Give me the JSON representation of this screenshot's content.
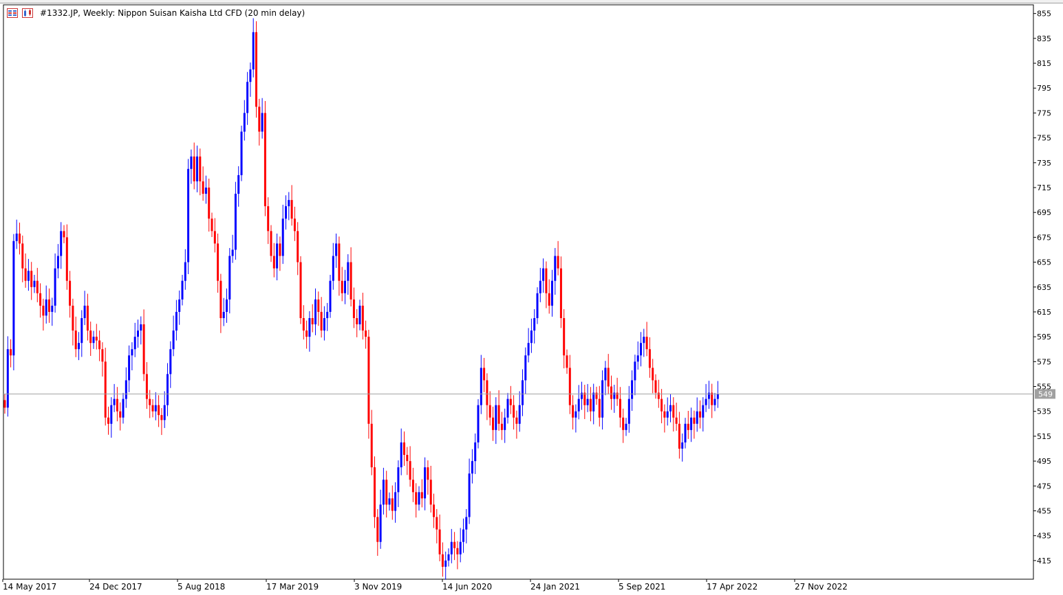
{
  "header": {
    "title": "#1332.JP, Weekly:  Nippon Suisan Kaisha Ltd CFD (20 min delay)"
  },
  "icons": {
    "left": "trade-panel-icon",
    "right": "chart-type-icon"
  },
  "colors": {
    "bull": "#0000ff",
    "bear": "#ff0000",
    "grid_frame": "#000000",
    "price_line": "#a0a0a0",
    "price_label_bg": "#a0a0a0"
  },
  "chart_data": {
    "type": "candlestick",
    "title": "#1332.JP, Weekly:  Nippon Suisan Kaisha Ltd CFD (20 min delay)",
    "ylim": [
      400,
      862
    ],
    "y_ticks": [
      855,
      835,
      815,
      795,
      775,
      755,
      735,
      715,
      695,
      675,
      655,
      635,
      615,
      595,
      575,
      555,
      535,
      515,
      495,
      475,
      455,
      435,
      415
    ],
    "x_tick_labels": [
      "14 May 2017",
      "24 Dec 2017",
      "5 Aug 2018",
      "17 Mar 2019",
      "3 Nov 2019",
      "14 Jun 2020",
      "24 Jan 2021",
      "5 Sep 2021",
      "17 Apr 2022",
      "27 Nov 2022"
    ],
    "current_price": 549,
    "closes": [
      538,
      585,
      580,
      672,
      678,
      670,
      650,
      640,
      648,
      635,
      640,
      630,
      620,
      612,
      625,
      615,
      620,
      650,
      660,
      680,
      675,
      640,
      620,
      600,
      585,
      590,
      610,
      620,
      600,
      590,
      595,
      592,
      585,
      575,
      530,
      525,
      540,
      545,
      535,
      530,
      545,
      560,
      580,
      585,
      595,
      600,
      605,
      565,
      545,
      540,
      535,
      540,
      532,
      528,
      540,
      565,
      585,
      600,
      615,
      625,
      640,
      655,
      730,
      740,
      720,
      740,
      720,
      710,
      715,
      690,
      680,
      670,
      640,
      610,
      615,
      625,
      660,
      665,
      710,
      725,
      760,
      775,
      800,
      810,
      840,
      780,
      760,
      775,
      700,
      680,
      660,
      650,
      670,
      660,
      690,
      700,
      705,
      690,
      680,
      655,
      610,
      600,
      595,
      610,
      605,
      625,
      615,
      600,
      610,
      615,
      640,
      660,
      670,
      640,
      630,
      640,
      655,
      625,
      610,
      605,
      620,
      600,
      595,
      525,
      490,
      450,
      430,
      460,
      480,
      460,
      465,
      455,
      470,
      490,
      510,
      500,
      495,
      480,
      470,
      460,
      470,
      465,
      490,
      480,
      460,
      450,
      440,
      420,
      410,
      415,
      420,
      430,
      425,
      420,
      430,
      440,
      450,
      485,
      495,
      510,
      540,
      570,
      560,
      540,
      530,
      520,
      540,
      525,
      520,
      530,
      545,
      540,
      530,
      525,
      540,
      560,
      580,
      590,
      600,
      610,
      630,
      640,
      650,
      630,
      620,
      640,
      660,
      650,
      610,
      580,
      570,
      540,
      530,
      535,
      545,
      550,
      540,
      545,
      535,
      550,
      545,
      530,
      560,
      570,
      555,
      545,
      550,
      545,
      530,
      520,
      525,
      545,
      560,
      575,
      580,
      590,
      595,
      585,
      570,
      560,
      550,
      545,
      535,
      530,
      535,
      540,
      530,
      525,
      505,
      510,
      525,
      520,
      530,
      525,
      535,
      530,
      540,
      545,
      550,
      540,
      545,
      549
    ],
    "wick": 8
  }
}
